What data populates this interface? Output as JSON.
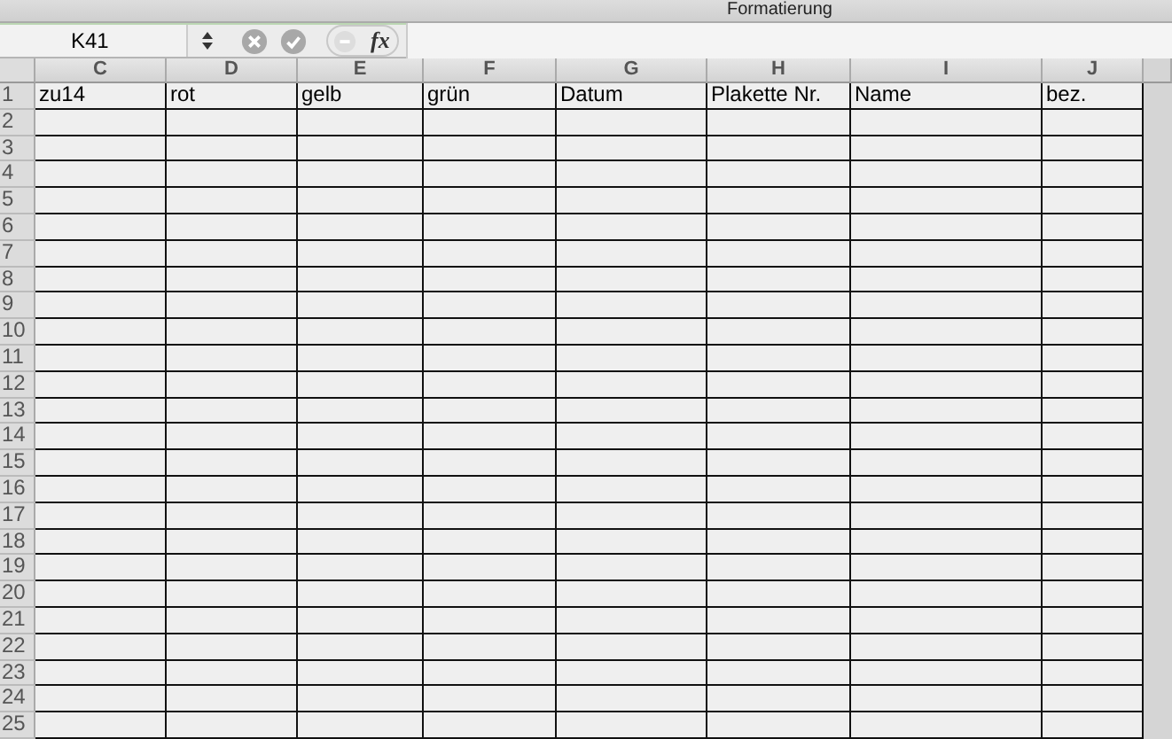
{
  "toolbar": {
    "label": "Formatierung"
  },
  "formula_bar": {
    "name_box": "K41",
    "function_button": "fx"
  },
  "columns": [
    "C",
    "D",
    "E",
    "F",
    "G",
    "H",
    "I",
    "J"
  ],
  "rows": [
    {
      "number": "1",
      "cells": [
        "zu14",
        "rot",
        "gelb",
        "grün",
        "Datum",
        "Plakette Nr.",
        "Name",
        "bez."
      ]
    },
    {
      "number": "2"
    },
    {
      "number": "3"
    },
    {
      "number": "4"
    },
    {
      "number": "5"
    },
    {
      "number": "6"
    },
    {
      "number": "7"
    },
    {
      "number": "8"
    },
    {
      "number": "9"
    },
    {
      "number": "10"
    },
    {
      "number": "11"
    },
    {
      "number": "12"
    },
    {
      "number": "13"
    },
    {
      "number": "14"
    },
    {
      "number": "15"
    },
    {
      "number": "16"
    },
    {
      "number": "17"
    },
    {
      "number": "18"
    },
    {
      "number": "19"
    },
    {
      "number": "20"
    },
    {
      "number": "21"
    },
    {
      "number": "22"
    },
    {
      "number": "23"
    },
    {
      "number": "24"
    },
    {
      "number": "25"
    }
  ]
}
